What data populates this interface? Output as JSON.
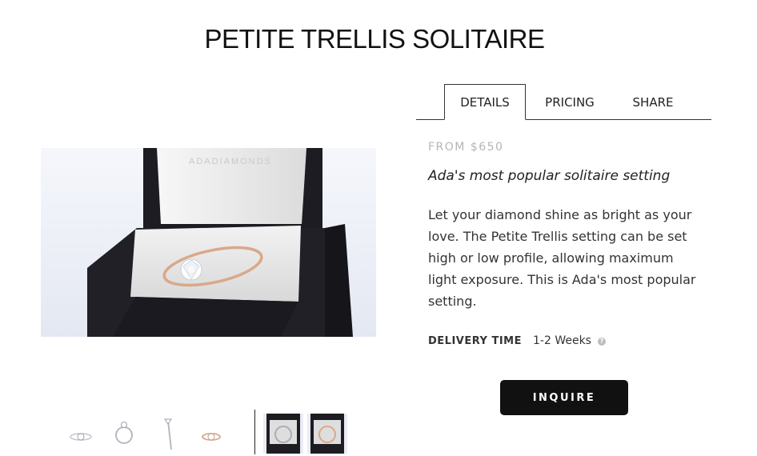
{
  "product": {
    "title": "PETITE TRELLIS SOLITAIRE",
    "box_brand": "ADADIAMONDS"
  },
  "tabs": [
    {
      "label": "DETAILS",
      "active": true
    },
    {
      "label": "PRICING",
      "active": false
    },
    {
      "label": "SHARE",
      "active": false
    }
  ],
  "details": {
    "from_price": "FROM $650",
    "tagline": "Ada's most popular solitaire setting",
    "description": "Let your diamond shine as bright as your love. The Petite Trellis setting can be set high or low profile, allowing maximum light exposure. This is Ada's most popular setting.",
    "delivery_label": "DELIVERY TIME",
    "delivery_value": "1-2 Weeks"
  },
  "inquire_label": "INQUIRE",
  "colors": {
    "accent": "#111111",
    "price_gray": "#b5b5b5",
    "rose_gold": "#d9a88a"
  },
  "thumbnails": [
    {
      "icon": "ring-top-view-icon"
    },
    {
      "icon": "ring-front-view-icon"
    },
    {
      "icon": "ring-side-view-icon"
    },
    {
      "icon": "ring-rose-gold-icon"
    },
    {
      "icon": "video-thumbnail-white-gold"
    },
    {
      "icon": "video-thumbnail-rose-gold"
    }
  ]
}
